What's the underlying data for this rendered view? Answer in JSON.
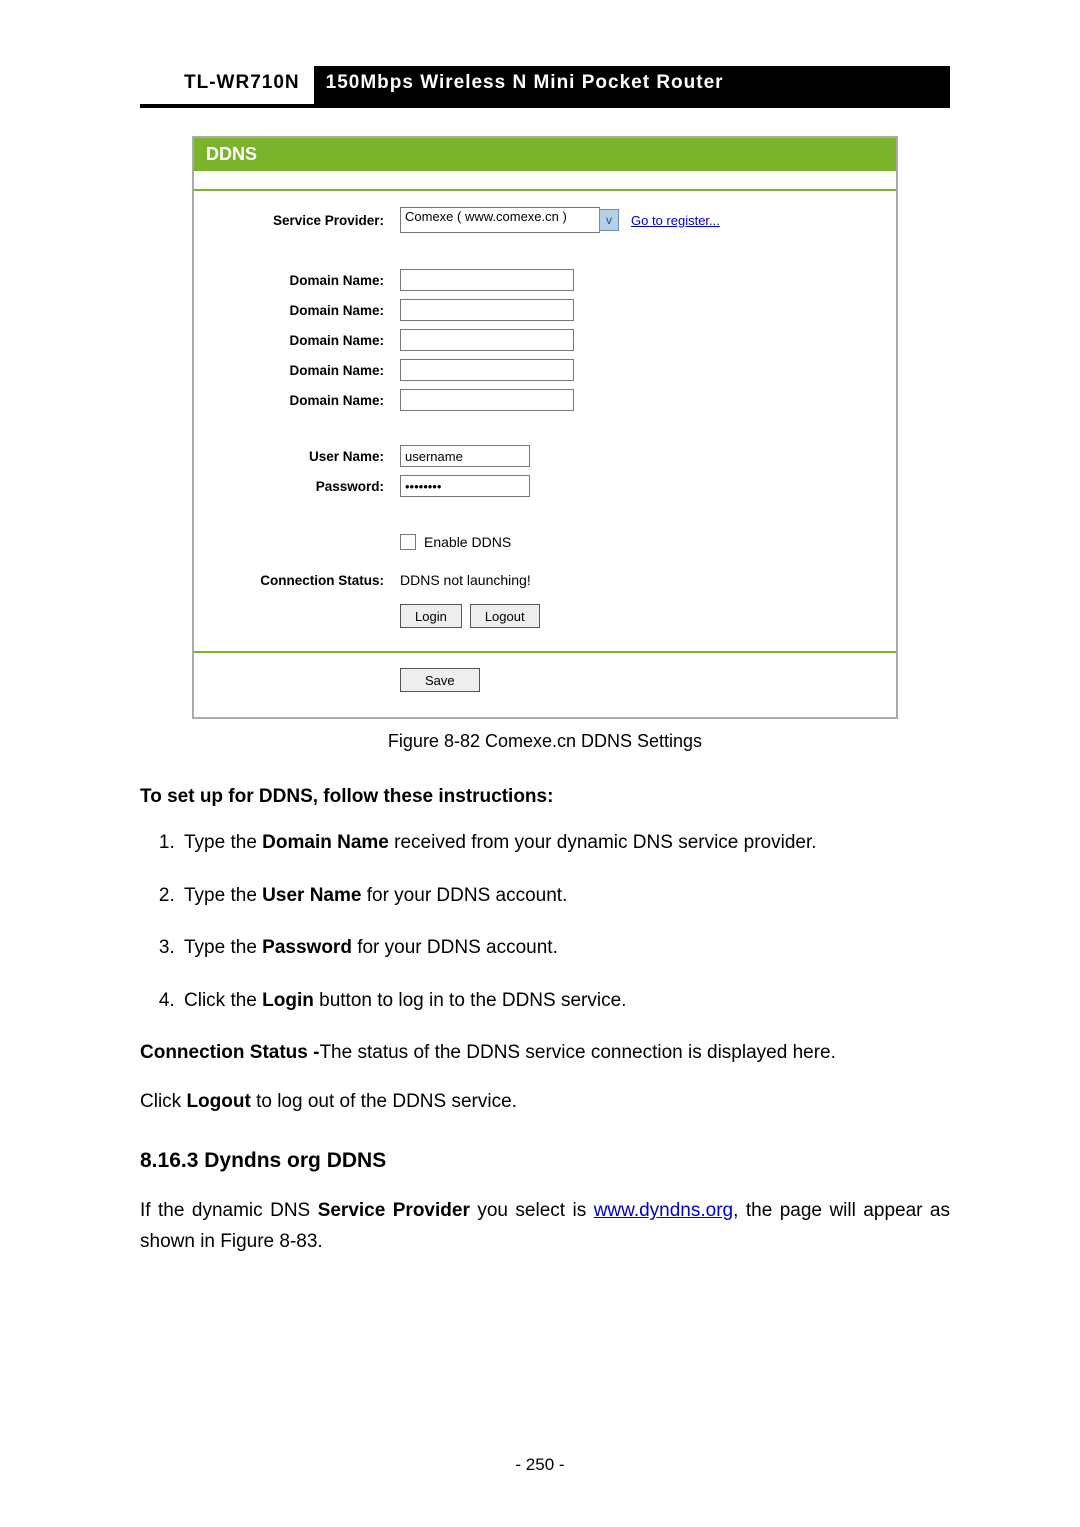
{
  "header": {
    "model": "TL-WR710N",
    "desc": "150Mbps Wireless N Mini Pocket Router"
  },
  "panel": {
    "title": "DDNS",
    "serviceProviderLabel": "Service Provider:",
    "serviceProviderValue": "Comexe ( www.comexe.cn )",
    "registerLink": "Go to register...",
    "domainLabel": "Domain Name:",
    "userNameLabel": "User Name:",
    "userNameValue": "username",
    "passwordLabel": "Password:",
    "passwordValue": "••••••••",
    "enableLabel": "Enable DDNS",
    "connStatusLabel": "Connection Status:",
    "connStatusValue": "DDNS not launching!",
    "loginBtn": "Login",
    "logoutBtn": "Logout",
    "saveBtn": "Save"
  },
  "caption": "Figure 8-82 Comexe.cn DDNS Settings",
  "instructionsHeader": "To set up for DDNS, follow these instructions:",
  "steps": {
    "s1a": "Type the ",
    "s1b": "Domain Name",
    "s1c": " received from your dynamic DNS service provider.",
    "s2a": "Type the ",
    "s2b": "User Name",
    "s2c": " for your DDNS account.",
    "s3a": "Type the ",
    "s3b": "Password",
    "s3c": " for your DDNS account.",
    "s4a": "Click the ",
    "s4b": "Login",
    "s4c": " button to log in to the DDNS service."
  },
  "para1": {
    "a": "Connection Status -",
    "b": "The status of the DDNS service connection is displayed here."
  },
  "para2": {
    "a": "Click ",
    "b": "Logout",
    "c": " to log out of the DDNS service."
  },
  "sectionTitle": "8.16.3 Dyndns org DDNS",
  "para3": {
    "a": "If the dynamic DNS ",
    "b": "Service Provider",
    "c": " you select is ",
    "link": "www.dyndns.org",
    "d": ", the page will appear as shown in Figure 8-83."
  },
  "pageNum": "- 250 -"
}
